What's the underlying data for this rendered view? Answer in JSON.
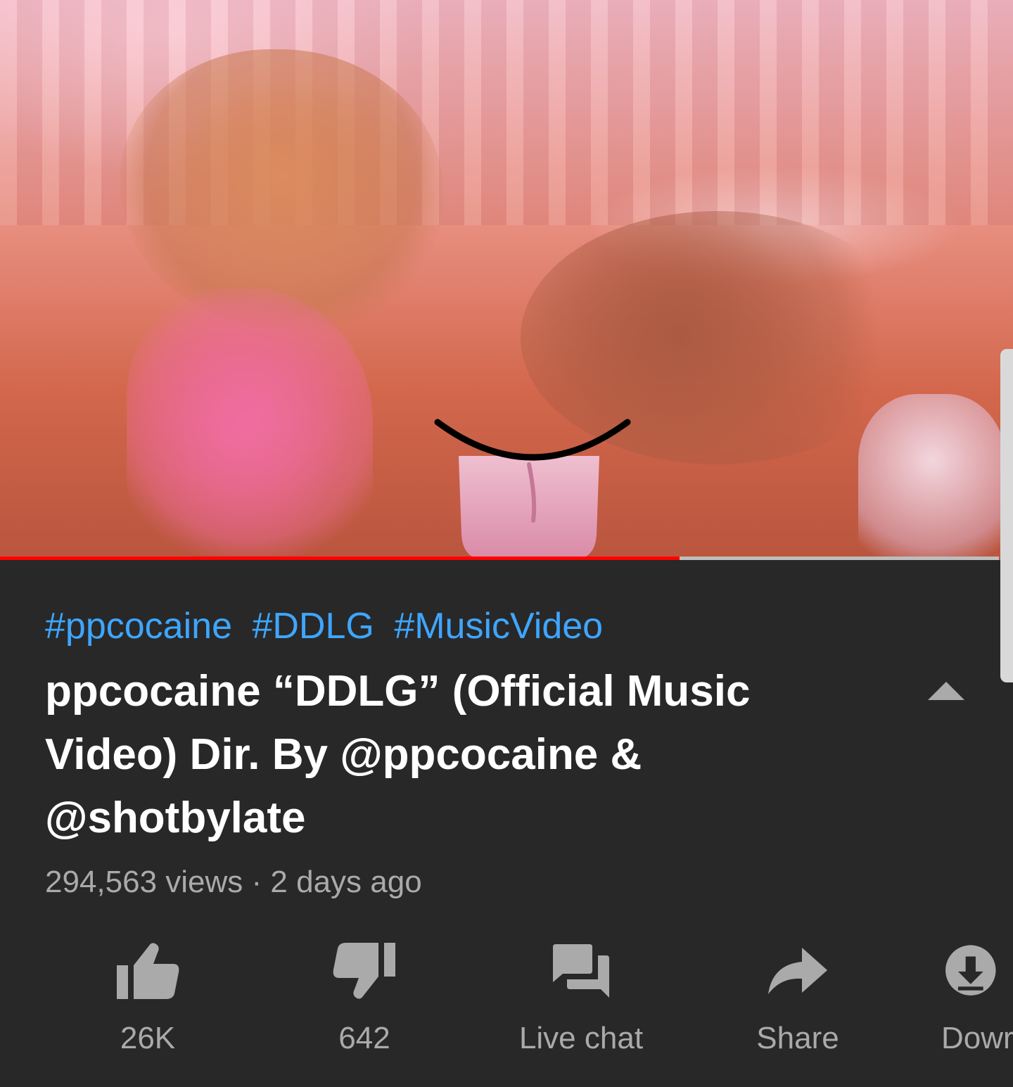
{
  "video": {
    "progress_fraction": 0.68,
    "censor_icon": "mouth-tongue-emoji"
  },
  "hashtags": [
    "#ppcocaine",
    "#DDLG",
    "#MusicVideo"
  ],
  "title": "ppcocaine  “DDLG” (Official Music Video) Dir. By @ppcocaine & @shotbylate",
  "meta": {
    "views": "294,563 views",
    "separator": "·",
    "age": "2 days ago"
  },
  "actions": {
    "like": {
      "label": "26K",
      "icon": "thumbs-up-icon"
    },
    "dislike": {
      "label": "642",
      "icon": "thumbs-down-icon"
    },
    "live_chat": {
      "label": "Live chat",
      "icon": "chat-bubbles-icon"
    },
    "share": {
      "label": "Share",
      "icon": "share-arrow-icon"
    },
    "download": {
      "label": "Dowr",
      "icon": "download-icon"
    }
  },
  "colors": {
    "background": "#282828",
    "hashtag": "#3ea6ff",
    "progress": "#ff0000",
    "secondary_text": "#aaaaaa"
  }
}
